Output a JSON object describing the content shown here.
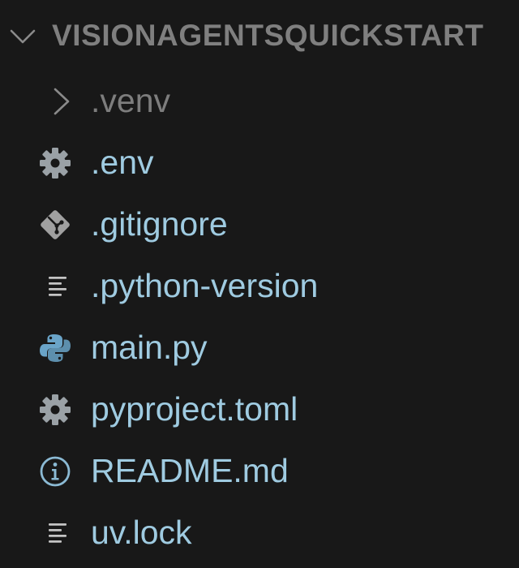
{
  "explorer": {
    "folder_title": "VISIONAGENTSQUICKSTART",
    "items": [
      {
        "label": ".venv",
        "icon": "chevron-right-icon",
        "type": "folder"
      },
      {
        "label": ".env",
        "icon": "gear-icon",
        "type": "file"
      },
      {
        "label": ".gitignore",
        "icon": "git-icon",
        "type": "file"
      },
      {
        "label": ".python-version",
        "icon": "lines-icon",
        "type": "file"
      },
      {
        "label": "main.py",
        "icon": "python-icon",
        "type": "file"
      },
      {
        "label": "pyproject.toml",
        "icon": "gear-icon",
        "type": "file"
      },
      {
        "label": "README.md",
        "icon": "info-icon",
        "type": "file"
      },
      {
        "label": "uv.lock",
        "icon": "lines-icon",
        "type": "file"
      }
    ]
  },
  "colors": {
    "background": "#181818",
    "file_label": "#9fcbe1",
    "folder_label": "#7d7d7d",
    "gear_icon": "#9aa1a6",
    "git_icon": "#a0a0a0",
    "python_icon": "#6aa4c8",
    "info_icon": "#8bbad4"
  }
}
